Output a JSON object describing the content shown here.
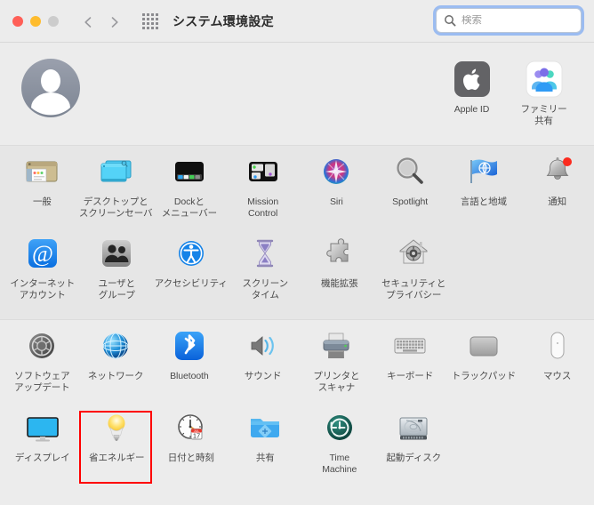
{
  "window": {
    "title": "システム環境設定",
    "traffic_lights": [
      "close",
      "minimize",
      "zoom"
    ],
    "nav_back": "back-arrow",
    "nav_forward": "forward-arrow",
    "grid_button": "show-all-grid"
  },
  "search": {
    "placeholder": "検索",
    "value": "",
    "icon": "search-icon",
    "focused": true,
    "focus_ring_color": "#5a96f5"
  },
  "account": {
    "avatar": "default-user-avatar",
    "items": [
      {
        "id": "apple-id",
        "label": "Apple ID",
        "icon": "apple-logo-icon"
      },
      {
        "id": "family-sharing",
        "label": "ファミリー\n共有",
        "icon": "family-sharing-icon"
      }
    ]
  },
  "sections": [
    {
      "id": "section-personal",
      "items": [
        {
          "id": "general",
          "label": "一般",
          "icon": "general-window-icon"
        },
        {
          "id": "desktop-screensaver",
          "label": "デスクトップと\nスクリーンセーバ",
          "icon": "desktop-icon"
        },
        {
          "id": "dock-menubar",
          "label": "Dockと\nメニューバー",
          "icon": "dock-icon"
        },
        {
          "id": "mission-control",
          "label": "Mission\nControl",
          "icon": "mission-control-icon"
        },
        {
          "id": "siri",
          "label": "Siri",
          "icon": "siri-icon"
        },
        {
          "id": "spotlight",
          "label": "Spotlight",
          "icon": "spotlight-icon"
        },
        {
          "id": "language-region",
          "label": "言語と地域",
          "icon": "language-flag-icon"
        },
        {
          "id": "notifications",
          "label": "通知",
          "icon": "notifications-bell-icon",
          "badge": true
        },
        {
          "id": "internet-accounts",
          "label": "インターネット\nアカウント",
          "icon": "internet-accounts-icon"
        },
        {
          "id": "users-groups",
          "label": "ユーザと\nグループ",
          "icon": "users-groups-icon"
        },
        {
          "id": "accessibility",
          "label": "アクセシビリティ",
          "icon": "accessibility-icon"
        },
        {
          "id": "screen-time",
          "label": "スクリーン\nタイム",
          "icon": "screen-time-hourglass-icon"
        },
        {
          "id": "extensions",
          "label": "機能拡張",
          "icon": "extensions-puzzle-icon"
        },
        {
          "id": "security-privacy",
          "label": "セキュリティと\nプライバシー",
          "icon": "security-privacy-house-icon"
        }
      ]
    },
    {
      "id": "section-hardware",
      "items": [
        {
          "id": "software-update",
          "label": "ソフトウェア\nアップデート",
          "icon": "software-update-gear-icon"
        },
        {
          "id": "network",
          "label": "ネットワーク",
          "icon": "network-globe-icon"
        },
        {
          "id": "bluetooth",
          "label": "Bluetooth",
          "icon": "bluetooth-icon"
        },
        {
          "id": "sound",
          "label": "サウンド",
          "icon": "sound-speaker-icon"
        },
        {
          "id": "printers-scanners",
          "label": "プリンタと\nスキャナ",
          "icon": "printer-icon"
        },
        {
          "id": "keyboard",
          "label": "キーボード",
          "icon": "keyboard-icon"
        },
        {
          "id": "trackpad",
          "label": "トラックパッド",
          "icon": "trackpad-icon"
        },
        {
          "id": "mouse",
          "label": "マウス",
          "icon": "mouse-icon"
        }
      ]
    },
    {
      "id": "section-system",
      "items": [
        {
          "id": "displays",
          "label": "ディスプレイ",
          "icon": "display-monitor-icon"
        },
        {
          "id": "energy-saver",
          "label": "省エネルギー",
          "icon": "lightbulb-icon",
          "highlighted": true
        },
        {
          "id": "date-time",
          "label": "日付と時刻",
          "icon": "clock-calendar-icon"
        },
        {
          "id": "sharing",
          "label": "共有",
          "icon": "sharing-folder-icon"
        },
        {
          "id": "time-machine",
          "label": "Time\nMachine",
          "icon": "time-machine-icon"
        },
        {
          "id": "startup-disk",
          "label": "起動ディスク",
          "icon": "startup-disk-icon"
        }
      ]
    }
  ],
  "highlight": {
    "target_id": "energy-saver",
    "color": "#ff0000",
    "border_width": 2
  }
}
